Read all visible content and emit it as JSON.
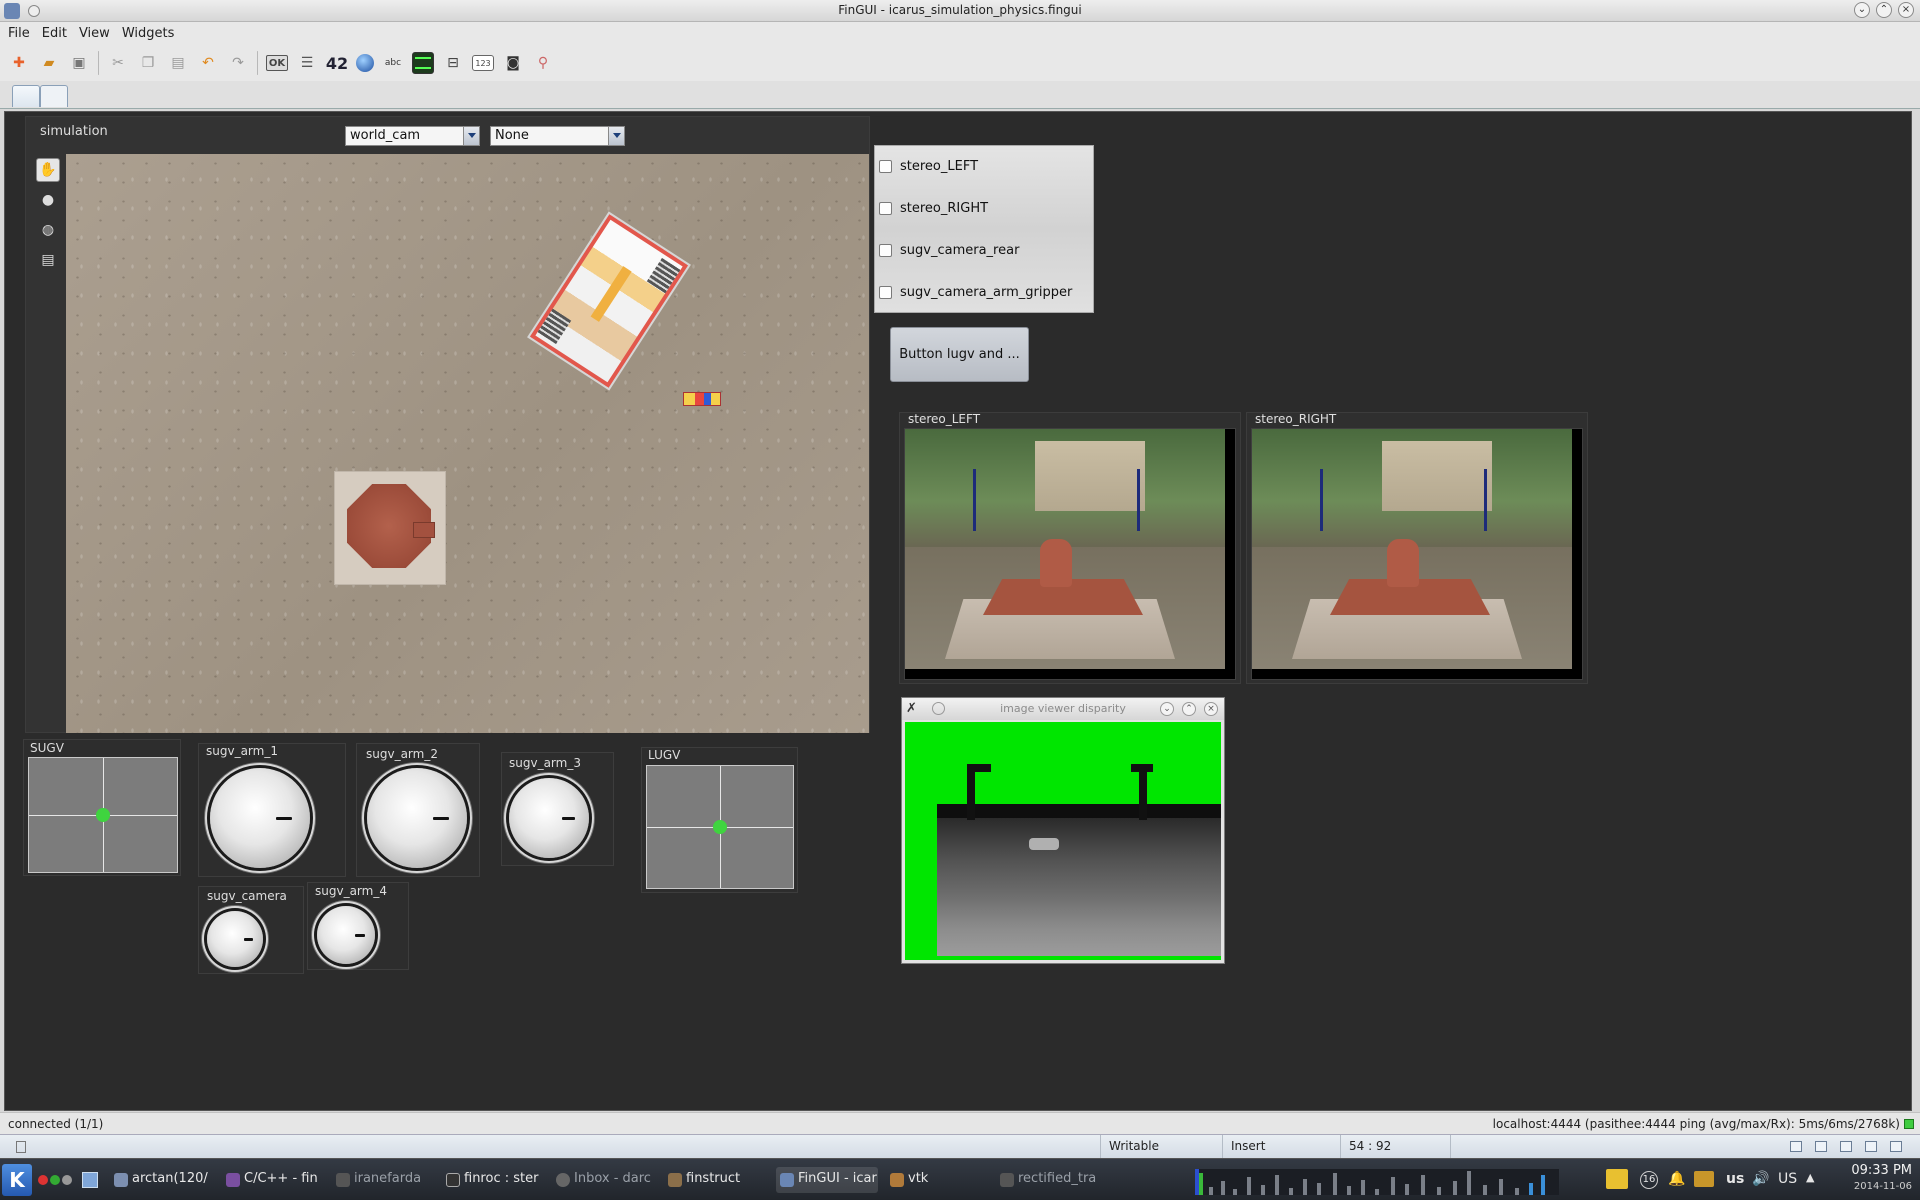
{
  "window": {
    "title": "FinGUI - icarus_simulation_physics.fingui"
  },
  "menu": [
    "File",
    "Edit",
    "View",
    "Widgets"
  ],
  "toolbar": {
    "icons": [
      "new-icon",
      "open-icon",
      "save-icon",
      "cut-icon",
      "copy-icon",
      "paste-icon",
      "undo-icon",
      "redo-icon",
      "ok-icon",
      "list-icon",
      "number-icon",
      "globe-icon",
      "abc-icon",
      "oscilloscope-icon",
      "slider-icon",
      "counter-icon",
      "camera-icon",
      "joystick-icon"
    ],
    "ok_label": "OK",
    "number_label": "42",
    "counter_label": "123"
  },
  "simulation": {
    "title": "simulation",
    "camera_select": "world_cam",
    "second_select": "None"
  },
  "cameras": {
    "checkboxes": [
      {
        "label": "stereo_LEFT",
        "checked": false
      },
      {
        "label": "stereo_RIGHT",
        "checked": false
      },
      {
        "label": "sugv_camera_rear",
        "checked": false
      },
      {
        "label": "sugv_camera_arm_gripper",
        "checked": false
      }
    ],
    "button_label": "Button lugv and ..."
  },
  "image_views": {
    "left_title": "stereo_LEFT",
    "right_title": "stereo_RIGHT",
    "disparity_title": "image viewer disparity"
  },
  "controls": {
    "sugv_label": "SUGV",
    "lugv_label": "LUGV",
    "arm1_label": "sugv_arm_1",
    "arm2_label": "sugv_arm_2",
    "arm3_label": "sugv_arm_3",
    "arm4_label": "sugv_arm_4",
    "camera_label": "sugv_camera"
  },
  "status": {
    "connection": "connected (1/1)",
    "server": "localhost:4444 (pasithee:4444 ping (avg/max/Rx): 5ms/6ms/2768k)",
    "mode": "Writable",
    "insert": "Insert",
    "cursor": "54 : 92"
  },
  "taskbar": {
    "tasks": [
      {
        "label": "arctan(120/",
        "active": false,
        "dim": false
      },
      {
        "label": "C/C++ - fin",
        "active": false,
        "dim": false
      },
      {
        "label": "iranefarda",
        "active": false,
        "dim": true
      },
      {
        "label": "finroc : ster",
        "active": false,
        "dim": false
      },
      {
        "label": "Inbox - darc",
        "active": false,
        "dim": true
      },
      {
        "label": "finstruct",
        "active": false,
        "dim": false
      },
      {
        "label": "FinGUI - icar",
        "active": true,
        "dim": false
      },
      {
        "label": "vtk",
        "active": false,
        "dim": false
      },
      {
        "label": "rectified_tra",
        "active": false,
        "dim": true
      }
    ],
    "notification_count": "16",
    "keyboard_layout": "us",
    "locale": "US",
    "time": "09:33 PM",
    "date": "2014-11-06"
  }
}
